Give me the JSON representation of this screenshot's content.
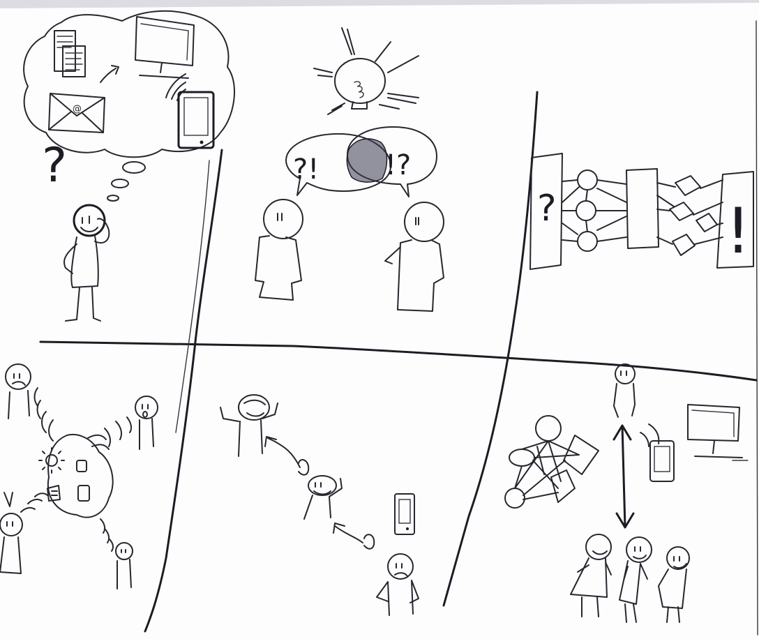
{
  "sketch": {
    "bubble_email_symbol": "@",
    "question_mark": "?",
    "exclamation_mark": "!",
    "speech_left": "?!",
    "speech_right": "!?"
  },
  "colors": {
    "paper": "#fdfdfd",
    "ink": "#1c1c24",
    "pencil": "#7a7a90"
  }
}
